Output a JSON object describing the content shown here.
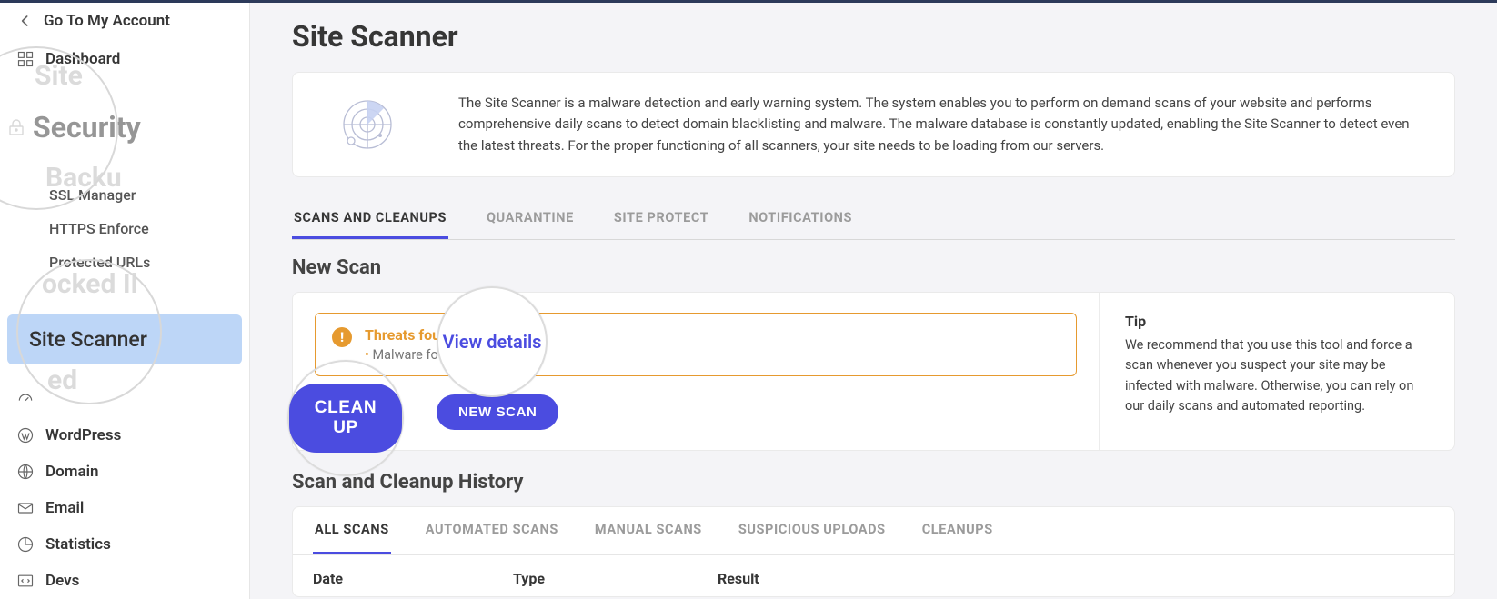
{
  "header": {
    "go_back": "Go To My Account"
  },
  "sidebar": {
    "ghost_site": "Site",
    "ghost_security": "Security",
    "ghost_backup": "Backu",
    "ghost_blocked": "ocked Il",
    "ghost_ed": "ed",
    "items": {
      "dashboard": "Dashboard",
      "ssl_manager": "SSL Manager",
      "https_enforce": "HTTPS Enforce",
      "protected_urls": "Protected URLs",
      "site_scanner": "Site Scanner",
      "wordpress": "WordPress",
      "domain": "Domain",
      "email": "Email",
      "statistics": "Statistics",
      "devs": "Devs"
    }
  },
  "page": {
    "title": "Site Scanner",
    "intro": "The Site Scanner is a malware detection and early warning system. The system enables you to perform on demand scans of your website and performs comprehensive daily scans to detect domain blacklisting and malware. The malware database is constantly updated, enabling the Site Scanner to detect even the latest threats. For the proper functioning of all scanners, your site needs to be loading from our servers."
  },
  "tabs": {
    "scans": "SCANS AND CLEANUPS",
    "quarantine": "QUARANTINE",
    "site_protect": "SITE PROTECT",
    "notifications": "NOTIFICATIONS"
  },
  "new_scan": {
    "heading": "New Scan",
    "alert_title": "Threats foun",
    "alert_detail": "Malware fou",
    "view_details": "View details",
    "clean_up": "CLEAN UP",
    "new_scan_btn": "NEW SCAN",
    "tip_title": "Tip",
    "tip_text": "We recommend that you use this tool and force a scan whenever you suspect your site may be infected with malware. Otherwise, you can rely on our daily scans and automated reporting."
  },
  "history": {
    "heading": "Scan and Cleanup History",
    "tabs": {
      "all": "ALL SCANS",
      "automated": "AUTOMATED SCANS",
      "manual": "MANUAL SCANS",
      "suspicious": "SUSPICIOUS UPLOADS",
      "cleanups": "CLEANUPS"
    },
    "columns": {
      "date": "Date",
      "type": "Type",
      "result": "Result"
    }
  }
}
